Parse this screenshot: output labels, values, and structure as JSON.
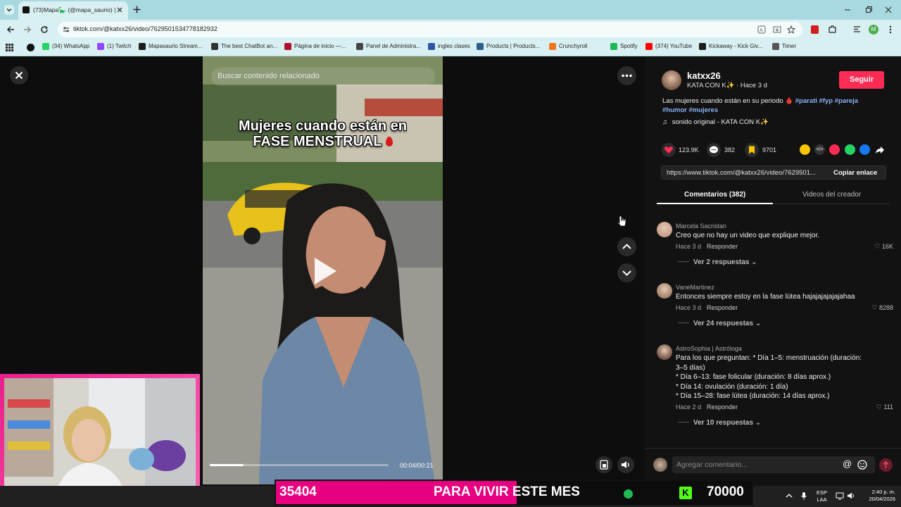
{
  "browser": {
    "tab_title": "(73)Mapa🦕 (@mapa_saurio) |",
    "url": "tiktok.com/@katxx26/video/7629501534778182932",
    "bookmarks": [
      {
        "label": "(34) WhatsApp",
        "icon": "whatsapp-icon",
        "color": "#25d366"
      },
      {
        "label": "(1) Twitch",
        "icon": "twitch-icon",
        "color": "#9146ff"
      },
      {
        "label": "Mapasaurio Stream...",
        "icon": "kick-icon",
        "color": "#1c1c1c"
      },
      {
        "label": "The best ChatBot an...",
        "icon": "openai-icon",
        "color": "#333333"
      },
      {
        "label": "Página de inicio —...",
        "icon": "notion-icon",
        "color": "#b0102a"
      },
      {
        "label": "Panel de Administra...",
        "icon": "admin-icon",
        "color": "#444444"
      },
      {
        "label": "ingles clases",
        "icon": "dots-icon",
        "color": "#2b57a5"
      },
      {
        "label": "Products | Products...",
        "icon": "products-icon",
        "color": "#2b5f8a"
      },
      {
        "label": "Crunchyroll",
        "icon": "crunchyroll-icon",
        "color": "#f47521"
      },
      {
        "label": "",
        "icon": "github-icon",
        "color": "#111111"
      },
      {
        "label": "Spotify",
        "icon": "spotify-icon",
        "color": "#1db954"
      },
      {
        "label": "(374) YouTube",
        "icon": "youtube-icon",
        "color": "#ff0000"
      },
      {
        "label": "Kickaway - Kick Giv...",
        "icon": "kick-icon",
        "color": "#1c1c1c"
      },
      {
        "label": "Timer",
        "icon": "timer-icon",
        "color": "#555555"
      }
    ]
  },
  "video": {
    "search_placeholder": "Buscar contenido relacionado",
    "caption_line1": "Mujeres cuando están en",
    "caption_line2": "FASE MENSTRUAL",
    "time": "00:04/00:21",
    "progress": 0.19
  },
  "creator": {
    "username": "katxx26",
    "display_name": "KATA CON K✨",
    "posted": "· Hace 3 d",
    "follow_label": "Seguir",
    "description": "Las mujeres cuando están en su periodo 🩸",
    "hashtags_line1": "#parati #fyp #pareja",
    "hashtags_line2": "#humor #mujeres",
    "sound": "sonido original - KATA CON K✨"
  },
  "stats": {
    "likes": "123.9K",
    "comments": "382",
    "saves": "9701"
  },
  "share": {
    "link": "https://www.tiktok.com/@katxx26/video/7629501...",
    "copy_label": "Copiar enlace"
  },
  "tabs": {
    "comments": "Comentarios (382)",
    "creator_videos": "Videos del creador"
  },
  "comments": [
    {
      "name": "Marcela Sacristan",
      "text": [
        "Creo que no hay un video que explique mejor."
      ],
      "time": "Hace 3 d",
      "reply": "Responder",
      "likes": "16K",
      "replies": "Ver 2 respuestas"
    },
    {
      "name": "VaneMartinez",
      "text": [
        "Entonces siempre estoy en la fase lútea hajajajajajajahaa"
      ],
      "time": "Hace 3 d",
      "reply": "Responder",
      "likes": "8288",
      "replies": "Ver 24 respuestas"
    },
    {
      "name": "AstroSophia | Astróloga",
      "text": [
        "Para los que preguntan: * Día 1–5: menstruación (duración:",
        "3–5 días)",
        "* Día 6–13: fase folicular (duración: 8 días aprox.)",
        "* Día 14: ovulación (duración: 1 día)",
        "* Día 15–28: fase lútea (duración: 14 días aprox.)"
      ],
      "time": "Hace 2 d",
      "reply": "Responder",
      "likes": "111",
      "replies": "Ver 10 respuestas"
    }
  ],
  "comment_input": {
    "placeholder": "Agregar comentario..."
  },
  "overlay_banner": {
    "left_number": "35404",
    "text": "PARA VIVIR ESTE MES",
    "right_number": "70000"
  },
  "taskbar": {
    "lang_top": "ESP",
    "lang_bottom": "LAA",
    "time": "2:40 p. m.",
    "date": "20/04/2026"
  },
  "colors": {
    "accent": "#fe2c55",
    "panel_bg": "#121212",
    "page_bg": "#0d0d0d",
    "banner_pink": "#e7007f",
    "chrome_bg": "#d9f0f3",
    "tabbar_bg": "#a8d8e0"
  }
}
